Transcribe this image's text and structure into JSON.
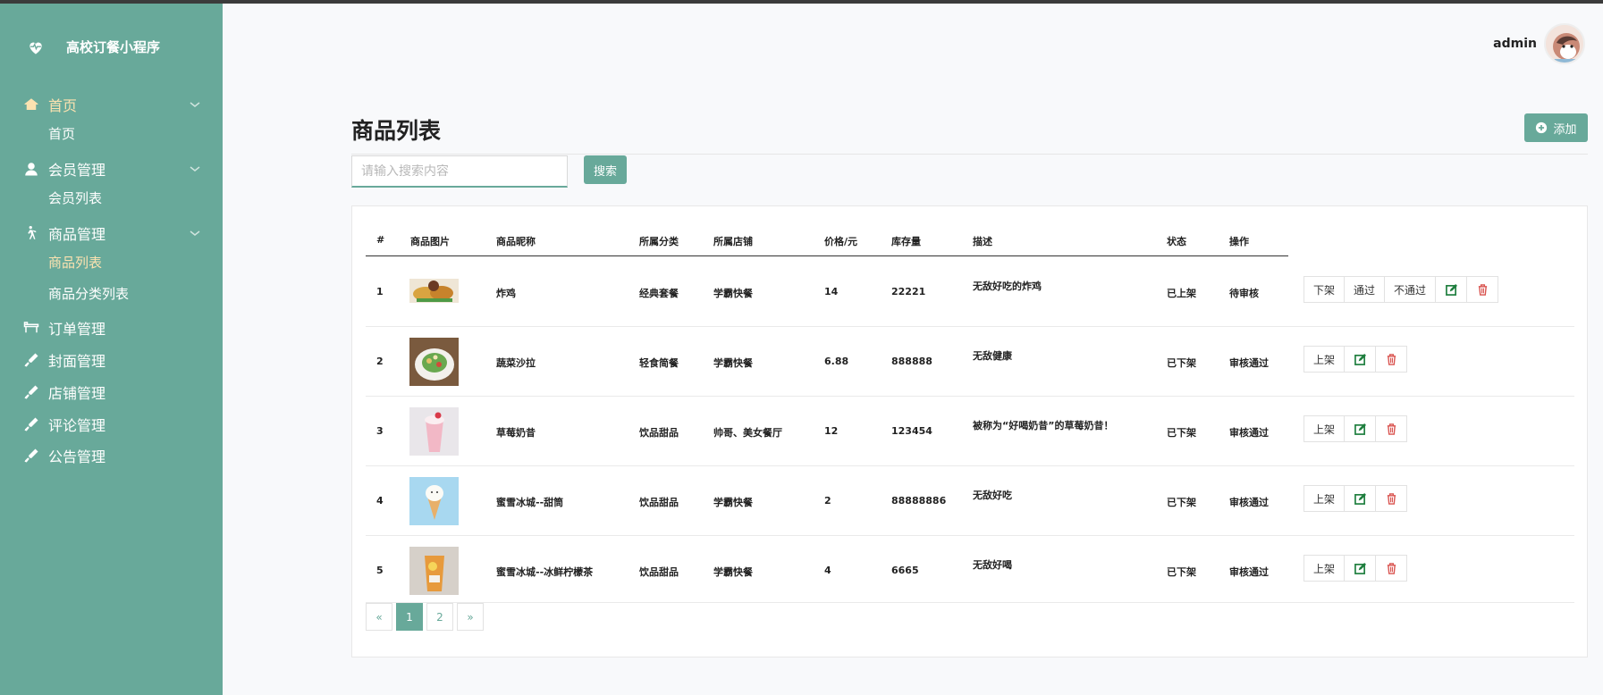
{
  "app": {
    "title": "高校订餐小程序"
  },
  "colors": {
    "sidebar": "#68a99a",
    "accent": "#68a99a",
    "active_text": "#fbe2b0",
    "edit_icon": "#1e7e3e",
    "delete_icon": "#d9534f"
  },
  "sidebar": {
    "groups": [
      {
        "label": "首页",
        "icon": "home-icon",
        "expanded": true,
        "children": [
          "首页"
        ]
      },
      {
        "label": "会员管理",
        "icon": "user-icon",
        "expanded": true,
        "children": [
          "会员列表"
        ]
      },
      {
        "label": "商品管理",
        "icon": "walking-icon",
        "expanded": true,
        "children": [
          "商品列表",
          "商品分类列表"
        ]
      },
      {
        "label": "订单管理",
        "icon": "table-icon",
        "expanded": false,
        "children": []
      },
      {
        "label": "封面管理",
        "icon": "brush-icon",
        "expanded": false,
        "children": []
      },
      {
        "label": "店铺管理",
        "icon": "brush-icon",
        "expanded": false,
        "children": []
      },
      {
        "label": "评论管理",
        "icon": "brush-icon",
        "expanded": false,
        "children": []
      },
      {
        "label": "公告管理",
        "icon": "brush-icon",
        "expanded": false,
        "children": []
      }
    ],
    "active_item": "商品列表"
  },
  "header": {
    "username": "admin"
  },
  "page": {
    "title": "商品列表",
    "add_label": "添加",
    "search": {
      "placeholder": "请输入搜索内容",
      "value": "",
      "button_label": "搜索"
    }
  },
  "table": {
    "columns": [
      "#",
      "商品图片",
      "商品昵称",
      "所属分类",
      "所属店铺",
      "价格/元",
      "库存量",
      "描述",
      "状态",
      "操作"
    ],
    "rows": [
      {
        "id": "1",
        "image": "fried-chicken",
        "name": "炸鸡",
        "category": "经典套餐",
        "shop": "学霸快餐",
        "price": "14",
        "stock": "22221",
        "desc": "无敌好吃的炸鸡",
        "shelf": "已上架",
        "review": "待审核",
        "actions": [
          "下架",
          "通过",
          "不通过"
        ]
      },
      {
        "id": "2",
        "image": "salad",
        "name": "蔬菜沙拉",
        "category": "轻食简餐",
        "shop": "学霸快餐",
        "price": "6.88",
        "stock": "888888",
        "desc": "无敌健康",
        "shelf": "已下架",
        "review": "审核通过",
        "actions": [
          "上架"
        ]
      },
      {
        "id": "3",
        "image": "milkshake",
        "name": "草莓奶昔",
        "category": "饮品甜品",
        "shop": "帅哥、美女餐厅",
        "price": "12",
        "stock": "123454",
        "desc": "被称为“好喝奶昔”的草莓奶昔！",
        "shelf": "已下架",
        "review": "审核通过",
        "actions": [
          "上架"
        ]
      },
      {
        "id": "4",
        "image": "ice-cream-cone",
        "name": "蜜雪冰城--甜筒",
        "category": "饮品甜品",
        "shop": "学霸快餐",
        "price": "2",
        "stock": "88888886",
        "desc": "无敌好吃",
        "shelf": "已下架",
        "review": "审核通过",
        "actions": [
          "上架"
        ]
      },
      {
        "id": "5",
        "image": "lemon-tea",
        "name": "蜜雪冰城--冰鲜柠檬茶",
        "category": "饮品甜品",
        "shop": "学霸快餐",
        "price": "4",
        "stock": "6665",
        "desc": "无敌好喝",
        "shelf": "已下架",
        "review": "审核通过",
        "actions": [
          "上架"
        ]
      }
    ]
  },
  "pagination": {
    "prev": "«",
    "pages": [
      "1",
      "2"
    ],
    "current": "1",
    "next": "»"
  }
}
